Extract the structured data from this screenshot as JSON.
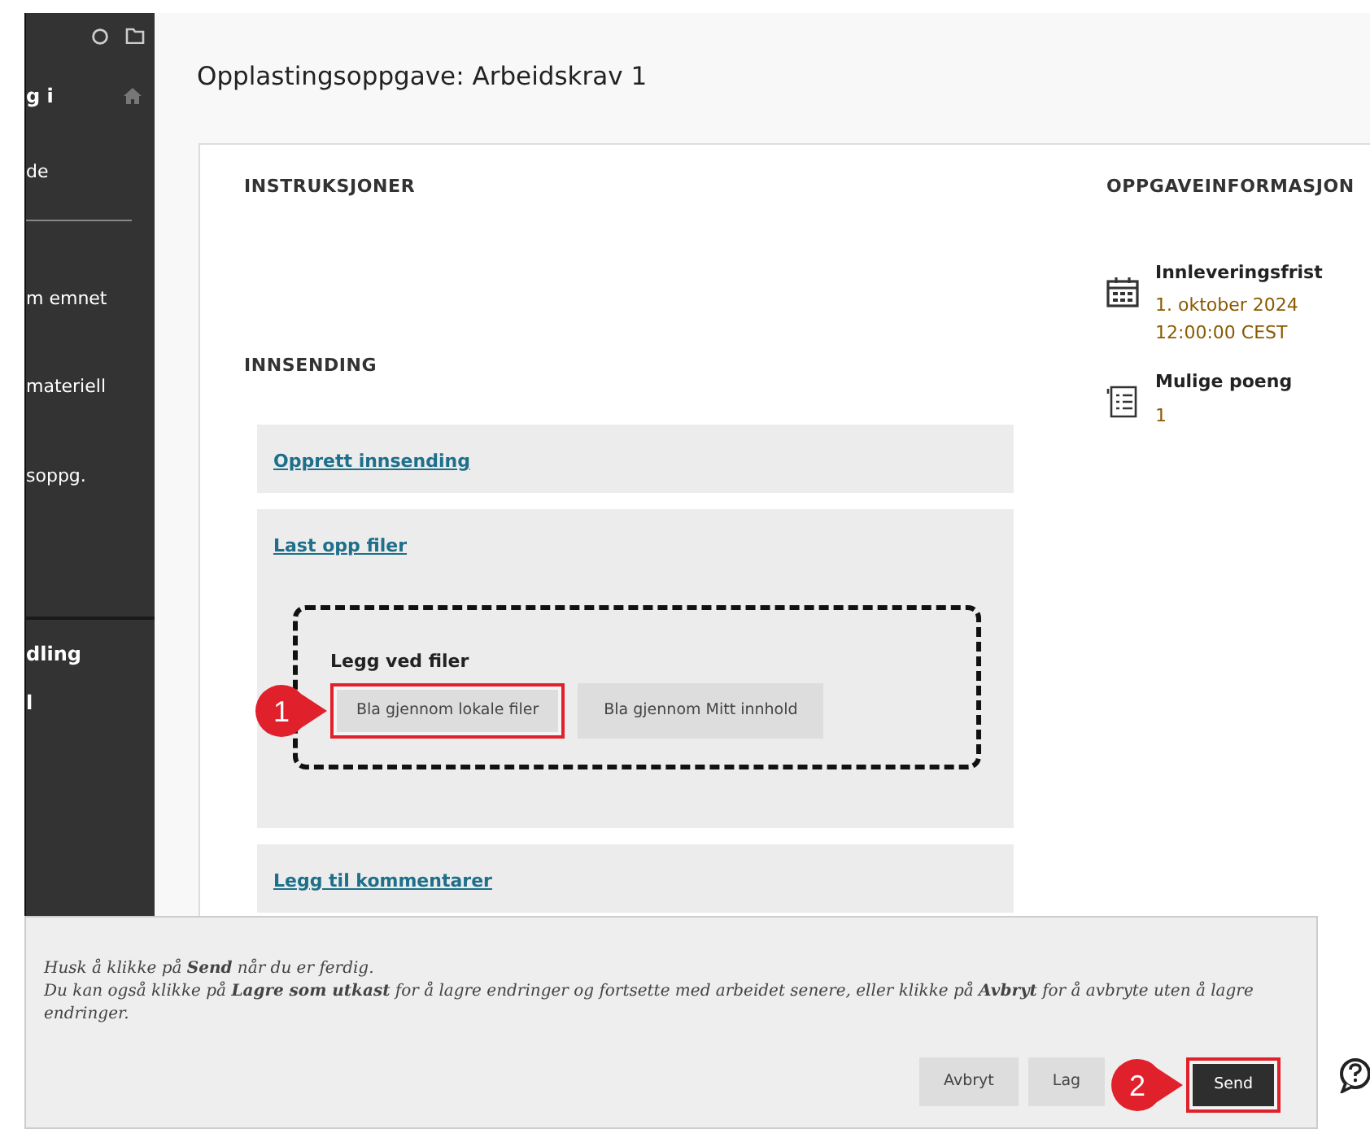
{
  "sidebar": {
    "items": [
      {
        "label": "g i",
        "kind": "heading"
      },
      {
        "label": "de",
        "kind": "link"
      },
      {
        "kind": "divider"
      },
      {
        "label": "m emnet",
        "kind": "link"
      },
      {
        "label": "materiell",
        "kind": "link"
      },
      {
        "label": "soppg.",
        "kind": "link"
      },
      {
        "kind": "separator"
      },
      {
        "label": "dling",
        "kind": "heading"
      },
      {
        "label": "l",
        "kind": "heading"
      }
    ]
  },
  "page_title": "Opplastingsoppgave: Arbeidskrav 1",
  "instructions": {
    "heading": "INSTRUKSJONER"
  },
  "submission": {
    "heading": "INNSENDING",
    "sections": [
      {
        "label": "Opprett innsending",
        "expanded": false
      },
      {
        "label": "Last opp filer",
        "expanded": true,
        "dropzone": {
          "label": "Legg ved filer",
          "buttons": [
            {
              "label": "Bla gjennom lokale filer",
              "highlighted": true,
              "callout": "1"
            },
            {
              "label": "Bla gjennom Mitt innhold",
              "highlighted": false
            }
          ]
        }
      },
      {
        "label": "Legg til kommentarer",
        "expanded": false
      }
    ]
  },
  "info": {
    "heading": "OPPGAVEINFORMASJON",
    "items": [
      {
        "kind": "calendar",
        "label": "Innleveringsfrist",
        "values": [
          "1. oktober 2024",
          "12:00:00 CEST"
        ]
      },
      {
        "kind": "checklist",
        "label": "Mulige poeng",
        "values": [
          "1"
        ]
      }
    ]
  },
  "footer": {
    "lines": [
      "Husk å klikke på **Send** når du er ferdig.",
      "Du kan også klikke på **Lagre som utkast** for å lagre endringer og fortsette med arbeidet senere, eller klikke på **Avbryt** for å avbryte uten å lagre endringer."
    ],
    "buttons": [
      {
        "label": "Avbryt",
        "kind": "secondary",
        "highlighted": false
      },
      {
        "label": "Lag",
        "kind": "secondary",
        "highlighted": false
      },
      {
        "label": "Send",
        "kind": "primary",
        "highlighted": true,
        "callout": "2"
      }
    ]
  }
}
